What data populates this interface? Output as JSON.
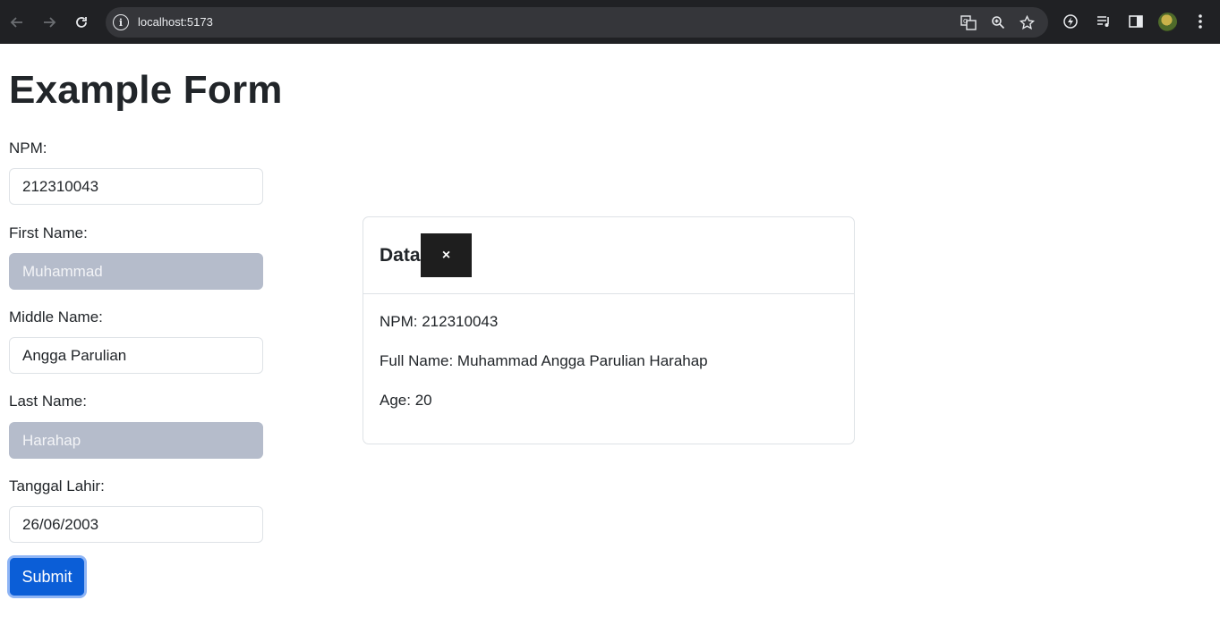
{
  "browser": {
    "url": "localhost:5173",
    "icons": {
      "back": "arrow-left-icon",
      "forward": "arrow-right-icon",
      "reload": "reload-icon",
      "info": "info-icon",
      "translate": "translate-icon",
      "zoom": "zoom-icon",
      "bookmark": "star-icon",
      "extension": "extension-icon",
      "media": "media-icon",
      "sidepanel": "side-panel-icon",
      "menu": "kebab-menu-icon"
    }
  },
  "form": {
    "title": "Example Form",
    "fields": {
      "npm": {
        "label": "NPM:",
        "value": "212310043"
      },
      "first_name": {
        "label": "First Name:",
        "value": "Muhammad"
      },
      "middle_name": {
        "label": "Middle Name:",
        "value": "Angga Parulian"
      },
      "last_name": {
        "label": "Last Name:",
        "value": "Harahap"
      },
      "birth_date": {
        "label": "Tanggal Lahir:",
        "value": "26/06/2003"
      }
    },
    "submit_label": "Submit"
  },
  "card": {
    "title": "Data",
    "close_label": "×",
    "lines": {
      "npm": "NPM: 212310043",
      "full_name": "Full Name: Muhammad Angga Parulian Harahap",
      "age": "Age: 20"
    }
  },
  "colors": {
    "primary": "#0d6efd",
    "disabled_input": "#b5bccb",
    "chrome_bg": "#202124"
  }
}
